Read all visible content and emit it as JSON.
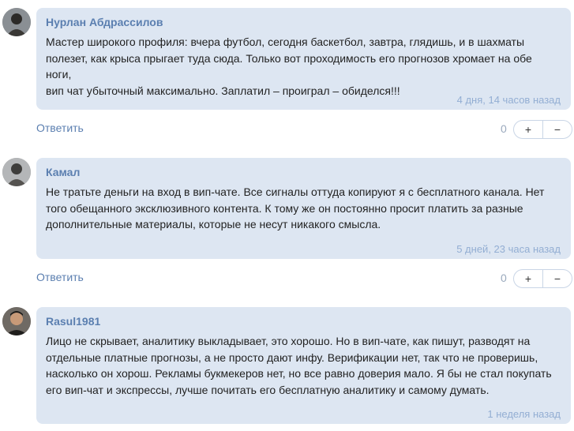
{
  "comments": [
    {
      "author": "Нурлан Абдрассилов",
      "text": "Мастер широкого профиля: вчера футбол, сегодня баскетбол, завтра, глядишь, и в шахматы\nполезет, как крыса прыгает туда сюда. Только вот проходимость его прогнозов хромает на обе ноги,\nвип чат убыточный максимально. Заплатил – проиграл – обиделся!!!",
      "time": "4 дня, 14 часов назад",
      "reply": "Ответить",
      "votes": "0",
      "plus": "+",
      "minus": "−"
    },
    {
      "author": "Камал",
      "text": "Не тратьте деньги на вход в вип-чате. Все сигналы оттуда копируют я с бесплатного канала. Нет\nтого обещанного эксклюзивного контента. К тому же он постоянно просит платить за разные\nдополнительные материалы, которые не несут никакого смысла.",
      "time": "5 дней, 23 часа назад",
      "reply": "Ответить",
      "votes": "0",
      "plus": "+",
      "minus": "−"
    },
    {
      "author": "Rasul1981",
      "text": "Лицо не скрывает, аналитику выкладывает, это хорошо. Но в вип-чате, как пишут, разводят на\nотдельные платные прогнозы, а не просто дают инфу. Верификации нет, так что не проверишь,\nнасколько он хорош. Рекламы букмекеров нет, но все равно доверия мало. Я бы не стал покупать\nего вип-чат и экспрессы, лучше почитать его бесплатную аналитику и самому думать.",
      "time": "1 неделя назад"
    }
  ]
}
